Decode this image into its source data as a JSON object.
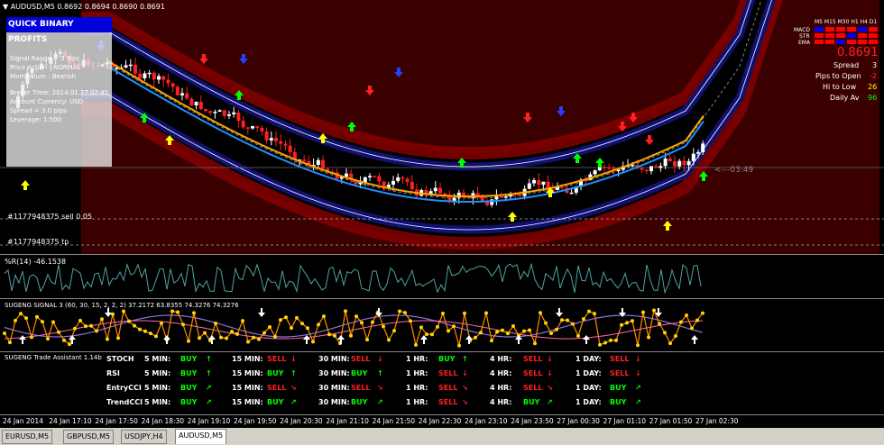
{
  "chart_header": "▼ AUDUSD,M5  0.8692 0.8694 0.8690 0.8691",
  "price_label": "0.8691",
  "info_panel": {
    "title": "QUICK BINARY PROFITS",
    "lines": [
      "Signal Range = 3 Pips",
      "Price Action : NORMAL",
      "Momentum : Bearish",
      "",
      "Broker Time: 2014.01.27 02:41",
      "Account Currency: USD",
      "Spread = 3.0 pips",
      "Leverage: 1:500"
    ]
  },
  "right_panel": {
    "tf_header": "M5 M15 M30 H1 H4 D1",
    "rows": [
      "MACD",
      "STR",
      "EMA"
    ],
    "stats": [
      {
        "label": "Spread",
        "value": "3",
        "color": "#ffffff"
      },
      {
        "label": "Pips to Open",
        "value": "-2",
        "color": "#ff3030"
      },
      {
        "label": "Hi to Low",
        "value": "26",
        "color": "#ffff00"
      },
      {
        "label": "Daily Av",
        "value": "96",
        "color": "#00ff00"
      }
    ]
  },
  "price_marker": "<---03:49",
  "order_lines": [
    "#1177948375 sell 0.05",
    "#1177948375 tp"
  ],
  "wpr_label": "%R(14) -46.1538",
  "signal_label": "SUGENG SIGNAL 3 (60, 30, 15, 2, 2, 2)  37.2172 63.8355 74.3276 74.3276",
  "ta_label": "SUGENG Trade Assistant 1.14b",
  "ta_rows": [
    {
      "name": "STOCH",
      "cells": [
        [
          "5 MIN:",
          "BUY",
          "↑"
        ],
        [
          "15 MIN:",
          "SELL",
          "↓"
        ],
        [
          "30 MIN:",
          "SELL",
          "↓"
        ],
        [
          "1 HR:",
          "BUY",
          "↑"
        ],
        [
          "4 HR:",
          "SELL",
          "↓"
        ],
        [
          "1 DAY:",
          "SELL",
          "↓"
        ]
      ]
    },
    {
      "name": "RSI",
      "cells": [
        [
          "5 MIN:",
          "BUY",
          "↑"
        ],
        [
          "15 MIN:",
          "BUY",
          "↑"
        ],
        [
          "30 MIN:",
          "BUY",
          "↑"
        ],
        [
          "1 HR:",
          "SELL",
          "↓"
        ],
        [
          "4 HR:",
          "SELL",
          "↓"
        ],
        [
          "1 DAY:",
          "SELL",
          "↓"
        ]
      ]
    },
    {
      "name": "EntryCCI",
      "cells": [
        [
          "5 MIN:",
          "BUY",
          "↗"
        ],
        [
          "15 MIN:",
          "SELL",
          "↘"
        ],
        [
          "30 MIN:",
          "SELL",
          "↘"
        ],
        [
          "1 HR:",
          "SELL",
          "↘"
        ],
        [
          "4 HR:",
          "SELL",
          "↘"
        ],
        [
          "1 DAY:",
          "BUY",
          "↗"
        ]
      ]
    },
    {
      "name": "TrendCCI",
      "cells": [
        [
          "5 MIN:",
          "BUY",
          "↗"
        ],
        [
          "15 MIN:",
          "BUY",
          "↗"
        ],
        [
          "30 MIN:",
          "BUY",
          "↗"
        ],
        [
          "1 HR:",
          "SELL",
          "↘"
        ],
        [
          "4 HR:",
          "BUY",
          "↗"
        ],
        [
          "1 DAY:",
          "BUY",
          "↗"
        ]
      ]
    }
  ],
  "x_axis": [
    "24 Jan 2014",
    "24 Jan 17:10",
    "24 Jan 17:50",
    "24 Jan 18:30",
    "24 Jan 19:10",
    "24 Jan 19:50",
    "24 Jan 20:30",
    "24 Jan 21:10",
    "24 Jan 21:50",
    "24 Jan 22:30",
    "24 Jan 23:10",
    "24 Jan 23:50",
    "27 Jan 00:30",
    "27 Jan 01:10",
    "27 Jan 01:50",
    "27 Jan 02:30"
  ],
  "tabs": [
    "EURUSD,M5",
    "GBPUSD,M5",
    "USDJPY,H4",
    "AUDUSD,M5"
  ],
  "active_tab": 3,
  "colors": {
    "buy": "#00ff00",
    "sell": "#ff2020",
    "band": "#8b0000",
    "blue_band": "#1010a0"
  }
}
